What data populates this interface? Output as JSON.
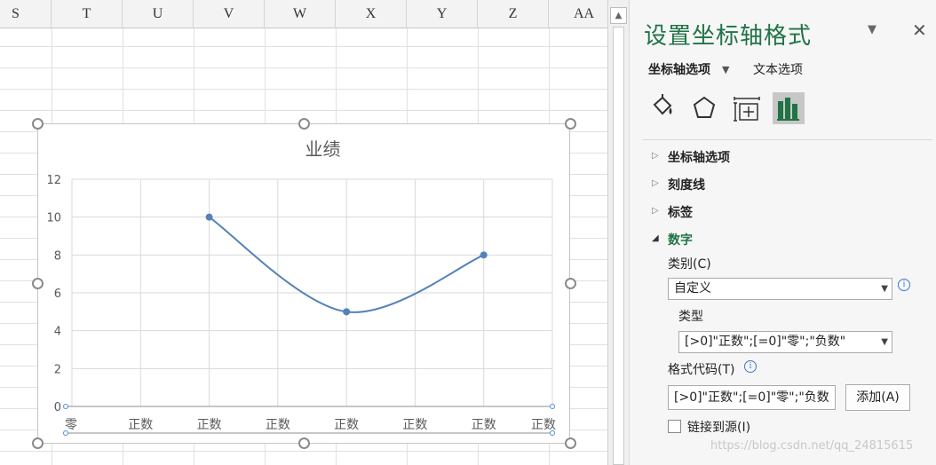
{
  "sheet": {
    "columns": [
      "S",
      "T",
      "U",
      "V",
      "W",
      "X",
      "Y",
      "Z",
      "AA"
    ]
  },
  "chart_data": {
    "type": "line",
    "title": "业绩",
    "categories": [
      "零",
      "正数",
      "正数",
      "正数",
      "正数",
      "正数",
      "正数",
      "正数"
    ],
    "series": [
      {
        "values": [
          null,
          null,
          10,
          null,
          5,
          null,
          8,
          null
        ]
      }
    ],
    "ylim": [
      0,
      12
    ],
    "yticks": [
      0,
      2,
      4,
      6,
      8,
      10,
      12
    ],
    "smooth": true,
    "grid": true,
    "line_color": "#5482b7"
  },
  "pane": {
    "title": "设置坐标轴格式",
    "tabs": {
      "axis_options": "坐标轴选项",
      "text_options": "文本选项"
    },
    "sections": {
      "axis_options": "坐标轴选项",
      "tick_marks": "刻度线",
      "labels": "标签",
      "number": "数字"
    },
    "number": {
      "category_label": "类别(C)",
      "category_value": "自定义",
      "type_label": "类型",
      "type_value": "[>0]\"正数\";[=0]\"零\";\"负数\"",
      "format_code_label": "格式代码(T)",
      "format_code_value": "[>0]\"正数\";[=0]\"零\";\"负数",
      "add_button": "添加(A)",
      "link_to_source": "链接到源(I)"
    },
    "accent_color": "#217346"
  },
  "watermark": "https://blog.csdn.net/qq_24815615"
}
